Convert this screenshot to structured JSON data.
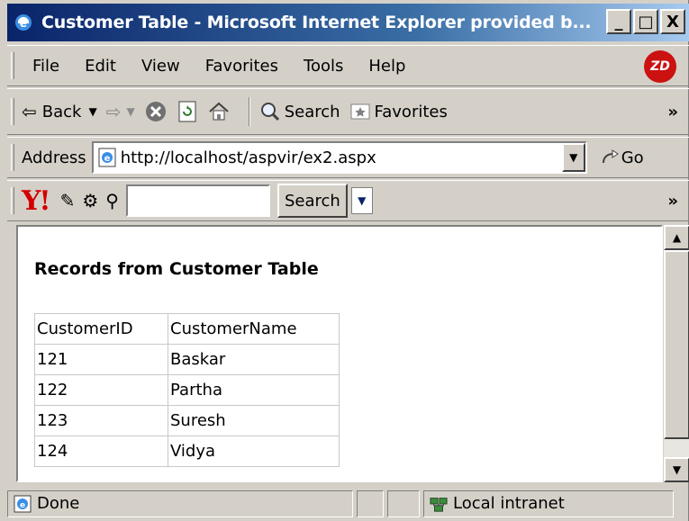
{
  "window": {
    "title": "Customer Table - Microsoft Internet Explorer provided b...",
    "controls": [
      "_",
      "□",
      "X"
    ]
  },
  "menubar": {
    "items": [
      "File",
      "Edit",
      "View",
      "Favorites",
      "Tools",
      "Help"
    ],
    "logo_text": "ZD"
  },
  "toolbar": {
    "back_label": "Back",
    "search_label": "Search",
    "favorites_label": "Favorites",
    "overflow": "»"
  },
  "address": {
    "label": "Address",
    "url": "http://localhost/aspvir/ex2.aspx",
    "go_label": "Go"
  },
  "yahoo_bar": {
    "logo": "Y!",
    "search_label": "Search",
    "overflow": "»"
  },
  "page": {
    "heading": "Records from Customer Table",
    "table": {
      "headers": [
        "CustomerID",
        "CustomerName"
      ],
      "rows": [
        [
          "121",
          "Baskar"
        ],
        [
          "122",
          "Partha"
        ],
        [
          "123",
          "Suresh"
        ],
        [
          "124",
          "Vidya"
        ]
      ]
    }
  },
  "status": {
    "text": "Done",
    "zone": "Local intranet"
  }
}
